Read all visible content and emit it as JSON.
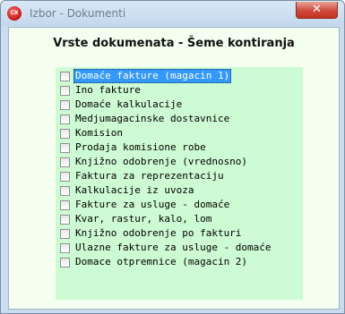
{
  "window": {
    "icon_text": "CX",
    "title": "Izbor - Dokumenti",
    "close_label": "✕"
  },
  "dialog": {
    "heading": "Vrste dokumenata - Šeme kontiranja"
  },
  "list": {
    "selected_index": 0,
    "items": [
      {
        "label": "Domaće fakture (magacin 1)",
        "checked": false
      },
      {
        "label": "Ino fakture",
        "checked": false
      },
      {
        "label": "Domaće kalkulacije",
        "checked": false
      },
      {
        "label": "Medjumagacinske dostavnice",
        "checked": false
      },
      {
        "label": "Komision",
        "checked": false
      },
      {
        "label": "Prodaja komisione robe",
        "checked": false
      },
      {
        "label": "Knjižno odobrenje (vrednosno)",
        "checked": false
      },
      {
        "label": "Faktura za reprezentaciju",
        "checked": false
      },
      {
        "label": "Kalkulacije iz uvoza",
        "checked": false
      },
      {
        "label": "Fakture za usluge - domaće",
        "checked": false
      },
      {
        "label": "Kvar, rastur, kalo, lom",
        "checked": false
      },
      {
        "label": "Knjižno odobrenje po fakturi",
        "checked": false
      },
      {
        "label": "Ulazne fakture za usluge - domaće",
        "checked": false
      },
      {
        "label": "Domace otpremnice (magacin 2)",
        "checked": false
      }
    ]
  }
}
